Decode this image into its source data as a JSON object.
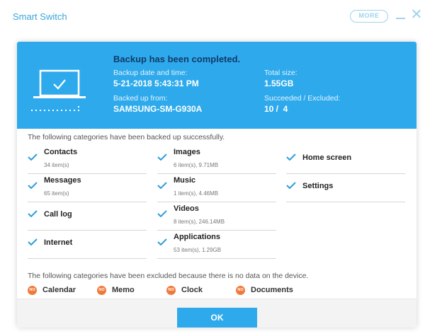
{
  "window": {
    "title": "Smart Switch",
    "more_label": "MORE"
  },
  "banner": {
    "heading": "Backup has been completed.",
    "date_label": "Backup date and time:",
    "date_value": "5-21-2018 5:43:31 PM",
    "from_label": "Backed up from:",
    "from_value": "SAMSUNG-SM-G930A",
    "size_label": "Total size:",
    "size_value": "1.55GB",
    "ratio_label": "Succeeded / Excluded:",
    "ratio_value": "10 /  4"
  },
  "backed_up": {
    "intro": "The following categories have been backed up successfully.",
    "items": [
      {
        "name": "Contacts",
        "detail": "34 item(s)"
      },
      {
        "name": "Messages",
        "detail": "65 item(s)"
      },
      {
        "name": "Call log",
        "detail": ""
      },
      {
        "name": "Internet",
        "detail": ""
      },
      {
        "name": "Images",
        "detail": "6 item(s), 9.71MB"
      },
      {
        "name": "Music",
        "detail": "1 item(s), 4.46MB"
      },
      {
        "name": "Videos",
        "detail": "8 item(s), 246.14MB"
      },
      {
        "name": "Applications",
        "detail": "53 item(s), 1.29GB"
      },
      {
        "name": "Home screen",
        "detail": ""
      },
      {
        "name": "Settings",
        "detail": ""
      }
    ]
  },
  "excluded": {
    "intro": "The following categories have been excluded because there is no data on the device.",
    "badge_text": "NO",
    "items": [
      "Calendar",
      "Memo",
      "Clock",
      "Documents"
    ]
  },
  "actions": {
    "ok_label": "OK"
  },
  "colors": {
    "accent": "#2eaaec",
    "heading": "#123a6a",
    "check": "#2e9fd8",
    "excluded_badge": "#f07a3c"
  },
  "icons": {
    "laptop": "laptop-check-icon",
    "check": "check-icon",
    "excluded": "no-data-icon"
  }
}
